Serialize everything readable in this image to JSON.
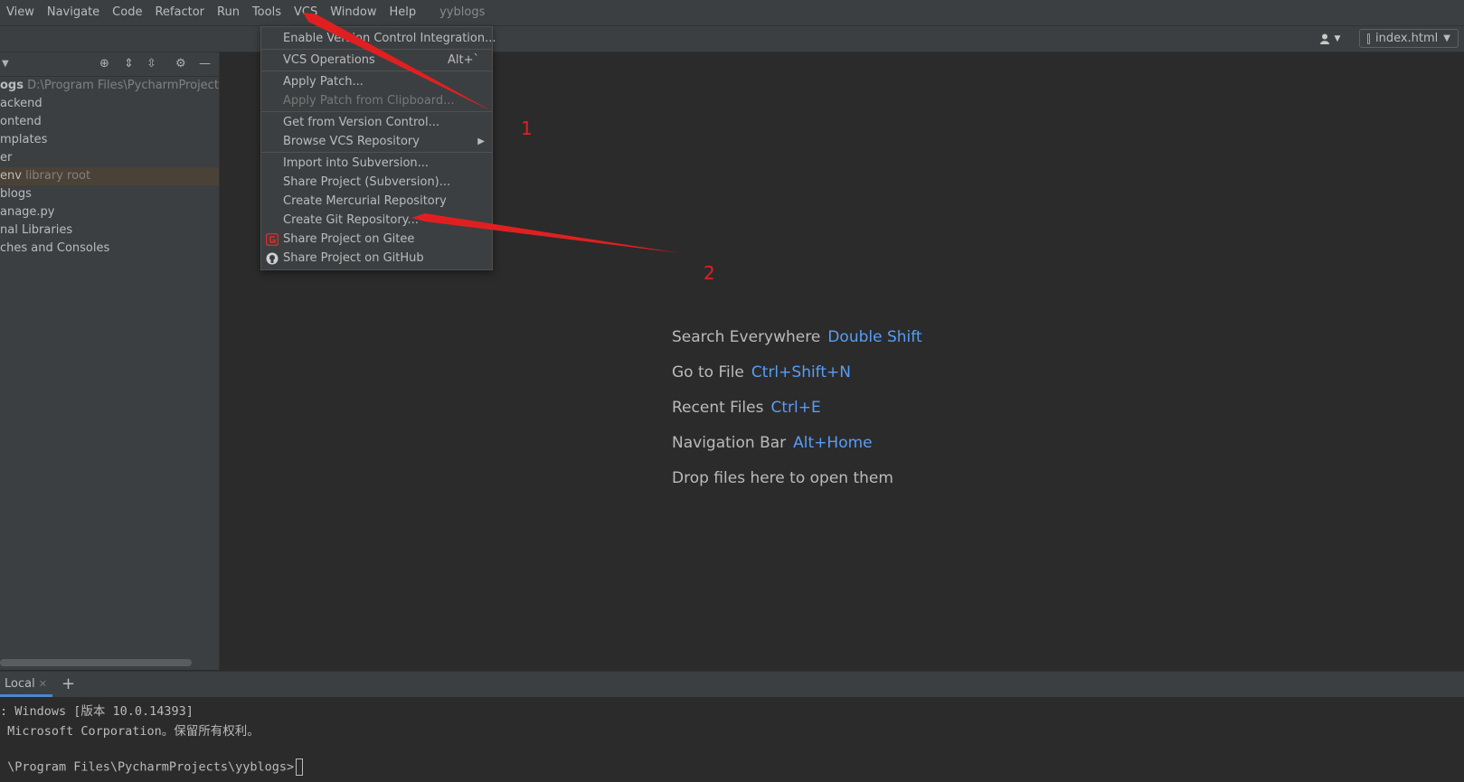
{
  "menubar": {
    "items": [
      "View",
      "Navigate",
      "Code",
      "Refactor",
      "Run",
      "Tools",
      "VCS",
      "Window",
      "Help"
    ],
    "project_name": "yyblogs"
  },
  "toolbar": {
    "run_config": "index.html"
  },
  "project_panel": {
    "rows": [
      {
        "name": "ogs",
        "hint": "D:\\Program Files\\PycharmProjects\\yyb"
      },
      {
        "name": "ackend",
        "hint": ""
      },
      {
        "name": "ontend",
        "hint": ""
      },
      {
        "name": "mplates",
        "hint": ""
      },
      {
        "name": "er",
        "hint": ""
      },
      {
        "name": "env",
        "hint": "library root"
      },
      {
        "name": "blogs",
        "hint": ""
      },
      {
        "name": "anage.py",
        "hint": ""
      },
      {
        "name": "nal Libraries",
        "hint": ""
      },
      {
        "name": "ches and Consoles",
        "hint": ""
      }
    ]
  },
  "vcs_menu": {
    "items": [
      {
        "label": "Enable Version Control Integration...",
        "shortcut": "",
        "disabled": false
      },
      {
        "label": "VCS Operations",
        "shortcut": "Alt+`",
        "disabled": false
      },
      {
        "label": "Apply Patch...",
        "shortcut": "",
        "disabled": false
      },
      {
        "label": "Apply Patch from Clipboard...",
        "shortcut": "",
        "disabled": true
      },
      {
        "label": "Get from Version Control...",
        "shortcut": "",
        "disabled": false
      },
      {
        "label": "Browse VCS Repository",
        "shortcut": "",
        "disabled": false
      },
      {
        "label": "Import into Subversion...",
        "shortcut": "",
        "disabled": false
      },
      {
        "label": "Share Project (Subversion)...",
        "shortcut": "",
        "disabled": false
      },
      {
        "label": "Create Mercurial Repository",
        "shortcut": "",
        "disabled": false
      },
      {
        "label": "Create Git Repository...",
        "shortcut": "",
        "disabled": false
      },
      {
        "label": "Share Project on Gitee",
        "shortcut": "",
        "disabled": false
      },
      {
        "label": "Share Project on GitHub",
        "shortcut": "",
        "disabled": false
      }
    ]
  },
  "editor_hints": [
    {
      "text": "Search Everywhere",
      "key": "Double Shift"
    },
    {
      "text": "Go to File",
      "key": "Ctrl+Shift+N"
    },
    {
      "text": "Recent Files",
      "key": "Ctrl+E"
    },
    {
      "text": "Navigation Bar",
      "key": "Alt+Home"
    },
    {
      "text": "Drop files here to open them",
      "key": ""
    }
  ],
  "terminal": {
    "tab_label": "Local",
    "lines": [
      ": Windows [版本 10.0.14393]",
      " Microsoft Corporation。保留所有权利。",
      "",
      " \\Program Files\\PycharmProjects\\yyblogs>"
    ]
  },
  "annotations": {
    "label_1": "1",
    "label_2": "2"
  },
  "colors": {
    "accent_key": "#589df6",
    "annotation": "#e02020",
    "background": "#2b2b2b",
    "panel": "#3c3f41"
  }
}
